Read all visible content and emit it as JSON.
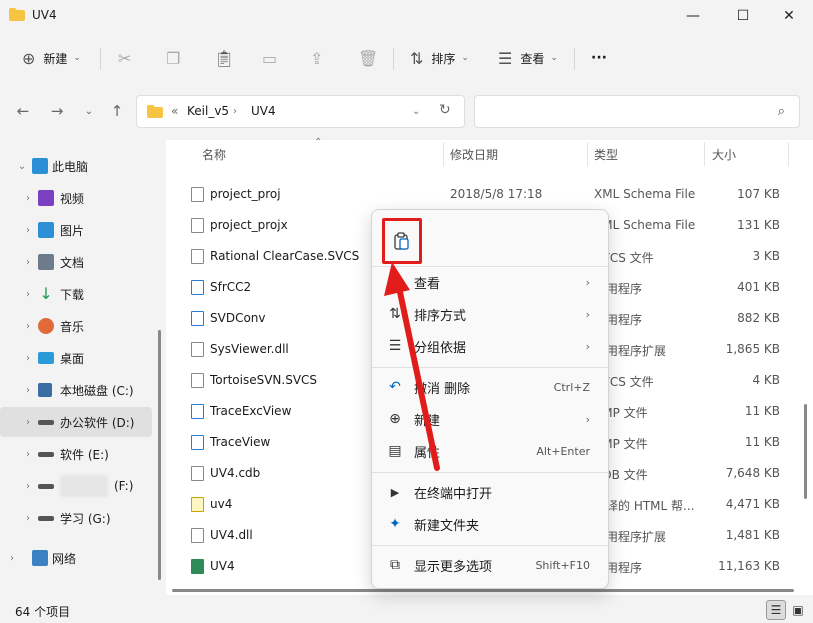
{
  "window": {
    "title": "UV4"
  },
  "toolbar": {
    "new_label": "新建",
    "sort_label": "排序",
    "view_label": "查看",
    "more_label": "···"
  },
  "address": {
    "overflow": "«",
    "path": [
      "Keil_v5",
      "UV4"
    ],
    "search_placeholder": ""
  },
  "sidebar": {
    "items": [
      {
        "label": "此电脑",
        "chevron": "⌄",
        "color": "#2b8fd6"
      },
      {
        "label": "视频",
        "chevron": "›",
        "color": "#7b3fc4"
      },
      {
        "label": "图片",
        "chevron": "›",
        "color": "#2d8fd5"
      },
      {
        "label": "文档",
        "chevron": "›",
        "color": "#6d7b8a"
      },
      {
        "label": "下载",
        "chevron": "›",
        "color": "#1e9a5a"
      },
      {
        "label": "音乐",
        "chevron": "›",
        "color": "#e06a3a"
      },
      {
        "label": "桌面",
        "chevron": "›",
        "color": "#2a9bd8"
      },
      {
        "label": "本地磁盘 (C:)",
        "chevron": "›",
        "color": "#3a6ea5"
      },
      {
        "label": "办公软件 (D:)",
        "chevron": "›",
        "color": "#555555"
      },
      {
        "label": "软件 (E:)",
        "chevron": "›",
        "color": "#555555"
      },
      {
        "label": "(F:)",
        "chevron": "›",
        "color": "#555555"
      },
      {
        "label": "学习 (G:)",
        "chevron": "›",
        "color": "#555555"
      },
      {
        "label": "网络",
        "chevron": "›",
        "color": "#3b82c4"
      }
    ]
  },
  "columns": {
    "name": "名称",
    "date": "修改日期",
    "type": "类型",
    "size": "大小"
  },
  "files": [
    {
      "name": "project_proj",
      "date": "2018/5/8 17:18",
      "type": "XML Schema File",
      "size": "107 KB"
    },
    {
      "name": "project_projx",
      "date": "",
      "type": "XML Schema File",
      "size": "131 KB"
    },
    {
      "name": "Rational ClearCase.SVCS",
      "date": "",
      "type": "SVCS 文件",
      "size": "3 KB"
    },
    {
      "name": "SfrCC2",
      "date": "",
      "type": "应用程序",
      "size": "401 KB"
    },
    {
      "name": "SVDConv",
      "date": "",
      "type": "应用程序",
      "size": "882 KB"
    },
    {
      "name": "SysViewer.dll",
      "date": "",
      "type": "应用程序扩展",
      "size": "1,865 KB"
    },
    {
      "name": "TortoiseSVN.SVCS",
      "date": "",
      "type": "SVCS 文件",
      "size": "4 KB"
    },
    {
      "name": "TraceExcView",
      "date": "",
      "type": "BMP 文件",
      "size": "11 KB"
    },
    {
      "name": "TraceView",
      "date": "",
      "type": "BMP 文件",
      "size": "11 KB"
    },
    {
      "name": "UV4.cdb",
      "date": "",
      "type": "CDB 文件",
      "size": "7,648 KB"
    },
    {
      "name": "uv4",
      "date": "",
      "type": "编译的 HTML 帮...",
      "size": "4,471 KB"
    },
    {
      "name": "UV4.dll",
      "date": "",
      "type": "应用程序扩展",
      "size": "1,481 KB"
    },
    {
      "name": "UV4",
      "date": "",
      "type": "应用程序",
      "size": "11,163 KB"
    }
  ],
  "context_menu": {
    "items": [
      {
        "icon": "☷",
        "label": "查看",
        "shortcut": "",
        "submenu": true
      },
      {
        "icon": "⇅",
        "label": "排序方式",
        "shortcut": "",
        "submenu": true
      },
      {
        "icon": "☰",
        "label": "分组依据",
        "shortcut": "",
        "submenu": true
      },
      {
        "icon": "↶",
        "label": "撤消 删除",
        "shortcut": "Ctrl+Z",
        "submenu": false
      },
      {
        "icon": "⊕",
        "label": "新建",
        "shortcut": "",
        "submenu": true
      },
      {
        "icon": "▤",
        "label": "属性",
        "shortcut": "Alt+Enter",
        "submenu": false
      },
      {
        "icon": "▶",
        "label": "在终端中打开",
        "shortcut": "",
        "submenu": false
      },
      {
        "icon": "✦",
        "label": "新建文件夹",
        "shortcut": "",
        "submenu": false
      },
      {
        "icon": "⧉",
        "label": "显示更多选项",
        "shortcut": "Shift+F10",
        "submenu": false
      }
    ]
  },
  "status": {
    "count": "64 个项目"
  },
  "colors": {
    "highlight_red": "#e21b1b",
    "accent_blue": "#0067c0",
    "folder_yellow": "#f6c342"
  }
}
